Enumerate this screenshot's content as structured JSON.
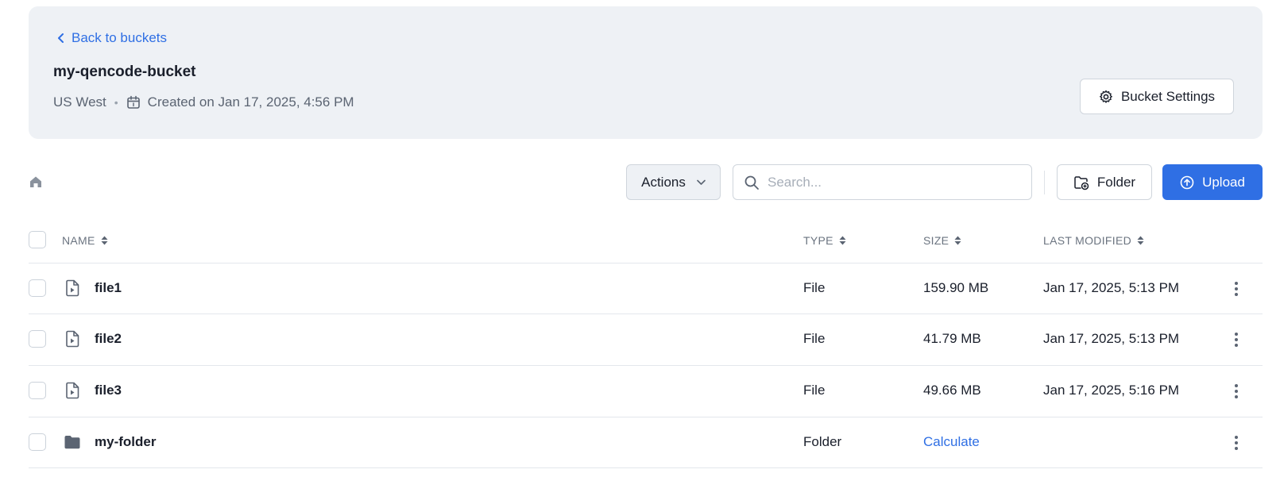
{
  "header": {
    "back_label": "Back to buckets",
    "bucket_name": "my-qencode-bucket",
    "region": "US West",
    "separator": "•",
    "created": "Created on Jan 17, 2025, 4:56 PM",
    "settings_label": "Bucket Settings"
  },
  "toolbar": {
    "actions_label": "Actions",
    "search_placeholder": "Search...",
    "folder_label": "Folder",
    "upload_label": "Upload"
  },
  "table": {
    "columns": {
      "name": "NAME",
      "type": "TYPE",
      "size": "SIZE",
      "modified": "LAST MODIFIED"
    },
    "rows": [
      {
        "name": "file1",
        "type": "File",
        "size": "159.90 MB",
        "modified": "Jan 17, 2025, 5:13 PM",
        "icon": "video-file-icon"
      },
      {
        "name": "file2",
        "type": "File",
        "size": "41.79 MB",
        "modified": "Jan 17, 2025, 5:13 PM",
        "icon": "video-file-icon"
      },
      {
        "name": "file3",
        "type": "File",
        "size": "49.66 MB",
        "modified": "Jan 17, 2025, 5:16 PM",
        "icon": "video-file-icon"
      },
      {
        "name": "my-folder",
        "type": "Folder",
        "size": "Calculate",
        "modified": "",
        "icon": "folder-icon"
      }
    ]
  },
  "colors": {
    "accent": "#2f6fe4",
    "header_bg": "#eef1f5",
    "border": "#cfd5dc"
  }
}
